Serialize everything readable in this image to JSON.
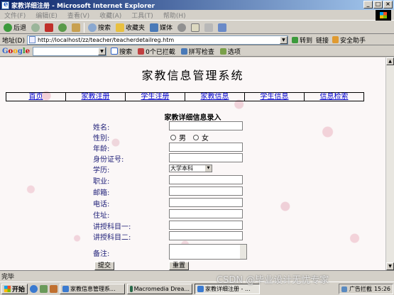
{
  "window": {
    "title": "家教详细注册 - Microsoft Internet Explorer",
    "buttons": [
      "_",
      "□",
      "×"
    ]
  },
  "menu": [
    "文件(F)",
    "编辑(E)",
    "查看(V)",
    "收藏(A)",
    "工具(T)",
    "帮助(H)"
  ],
  "toolbar": {
    "back": "后退",
    "forward": "→",
    "search": "搜索",
    "favorites": "收藏夹",
    "media": "媒体"
  },
  "address": {
    "label": "地址(D)",
    "url": "http://localhost/zz/teacher/teacherdetailreg.htm",
    "go": "转到",
    "links": "链接",
    "helper": "安全助手"
  },
  "google": {
    "logo": "Google",
    "search": "搜索",
    "blocked": "0个已拦截",
    "spell": "拼写检查",
    "options": "选项"
  },
  "page": {
    "site_title": "家教信息管理系统",
    "nav": [
      "首页",
      "家教注册",
      "学生注册",
      "家教信息",
      "学生信息",
      "信息检索"
    ],
    "form_heading": "家教详细信息录入",
    "fields": {
      "name": "姓名:",
      "gender": "性别:",
      "age": "年龄:",
      "id_number": "身份证号:",
      "education": "学历:",
      "occupation": "职业:",
      "email": "邮箱:",
      "phone": "电话:",
      "address": "住址:",
      "subject1": "讲授科目一:",
      "subject2": "讲授科目二:",
      "remarks": "备注:"
    },
    "gender_options": {
      "male": "男",
      "female": "女"
    },
    "education_selected": "大学本科",
    "submit": "提交",
    "reset": "重置"
  },
  "status": {
    "text": "完毕"
  },
  "taskbar": {
    "start": "开始",
    "tasks": [
      "家教信息管理系...",
      "Macromedia Drea...",
      "家教详细注册 - ..."
    ],
    "tray_text": "广告拦截",
    "clock": "15:26"
  },
  "watermark": "CSDN @毕业设计无忧专家"
}
